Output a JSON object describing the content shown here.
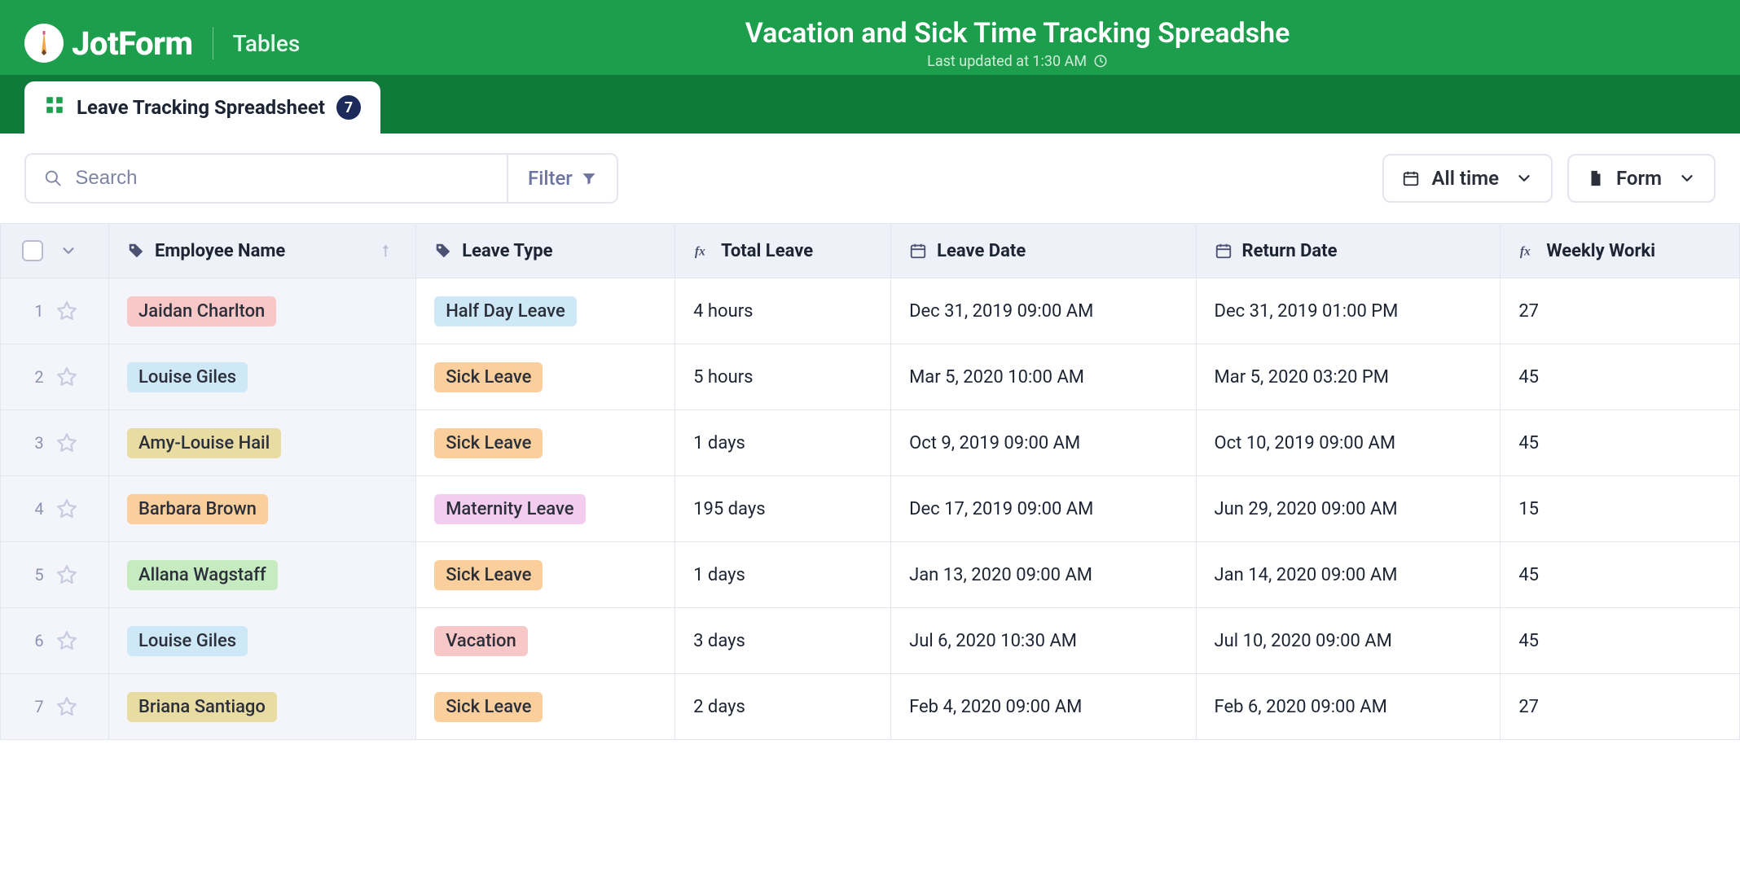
{
  "header": {
    "brand": "JotForm",
    "product": "Tables",
    "title": "Vacation and Sick Time Tracking Spreadshe",
    "subtitle": "Last updated at 1:30 AM"
  },
  "tab": {
    "label": "Leave Tracking Spreadsheet",
    "count": "7"
  },
  "toolbar": {
    "search_placeholder": "Search",
    "filter_label": "Filter",
    "timerange_label": "All time",
    "form_label": "Form"
  },
  "columns": [
    {
      "key": "employee",
      "label": "Employee Name",
      "icon": "tag"
    },
    {
      "key": "leave_type",
      "label": "Leave Type",
      "icon": "tag"
    },
    {
      "key": "total_leave",
      "label": "Total Leave",
      "icon": "fx"
    },
    {
      "key": "leave_date",
      "label": "Leave Date",
      "icon": "calendar"
    },
    {
      "key": "return_date",
      "label": "Return Date",
      "icon": "calendar"
    },
    {
      "key": "weekly_working",
      "label": "Weekly Worki",
      "icon": "fx"
    }
  ],
  "rows": [
    {
      "num": "1",
      "employee": "Jaidan Charlton",
      "emp_color": "c-pink",
      "leave_type": "Half Day Leave",
      "lt_color": "c-blue",
      "total_leave": "4 hours",
      "leave_date": "Dec 31, 2019 09:00 AM",
      "return_date": "Dec 31, 2019 01:00 PM",
      "weekly_working": "27"
    },
    {
      "num": "2",
      "employee": "Louise Giles",
      "emp_color": "c-blue",
      "leave_type": "Sick Leave",
      "lt_color": "c-orange",
      "total_leave": "5 hours",
      "leave_date": "Mar 5, 2020 10:00 AM",
      "return_date": "Mar 5, 2020 03:20 PM",
      "weekly_working": "45"
    },
    {
      "num": "3",
      "employee": "Amy-Louise Hail",
      "emp_color": "c-tan",
      "leave_type": "Sick Leave",
      "lt_color": "c-orange",
      "total_leave": "1 days",
      "leave_date": "Oct 9, 2019 09:00 AM",
      "return_date": "Oct 10, 2019 09:00 AM",
      "weekly_working": "45"
    },
    {
      "num": "4",
      "employee": "Barbara Brown",
      "emp_color": "c-orange",
      "leave_type": "Maternity Leave",
      "lt_color": "c-lilac",
      "total_leave": "195 days",
      "leave_date": "Dec 17, 2019 09:00 AM",
      "return_date": "Jun 29, 2020 09:00 AM",
      "weekly_working": "15"
    },
    {
      "num": "5",
      "employee": "Allana Wagstaff",
      "emp_color": "c-green",
      "leave_type": "Sick Leave",
      "lt_color": "c-orange",
      "total_leave": "1 days",
      "leave_date": "Jan 13, 2020 09:00 AM",
      "return_date": "Jan 14, 2020 09:00 AM",
      "weekly_working": "45"
    },
    {
      "num": "6",
      "employee": "Louise Giles",
      "emp_color": "c-blue",
      "leave_type": "Vacation",
      "lt_color": "c-pink",
      "total_leave": "3 days",
      "leave_date": "Jul 6, 2020 10:30 AM",
      "return_date": "Jul 10, 2020 09:00 AM",
      "weekly_working": "45"
    },
    {
      "num": "7",
      "employee": "Briana Santiago",
      "emp_color": "c-tan",
      "leave_type": "Sick Leave",
      "lt_color": "c-orange",
      "total_leave": "2 days",
      "leave_date": "Feb 4, 2020 09:00 AM",
      "return_date": "Feb 6, 2020 09:00 AM",
      "weekly_working": "27"
    }
  ]
}
